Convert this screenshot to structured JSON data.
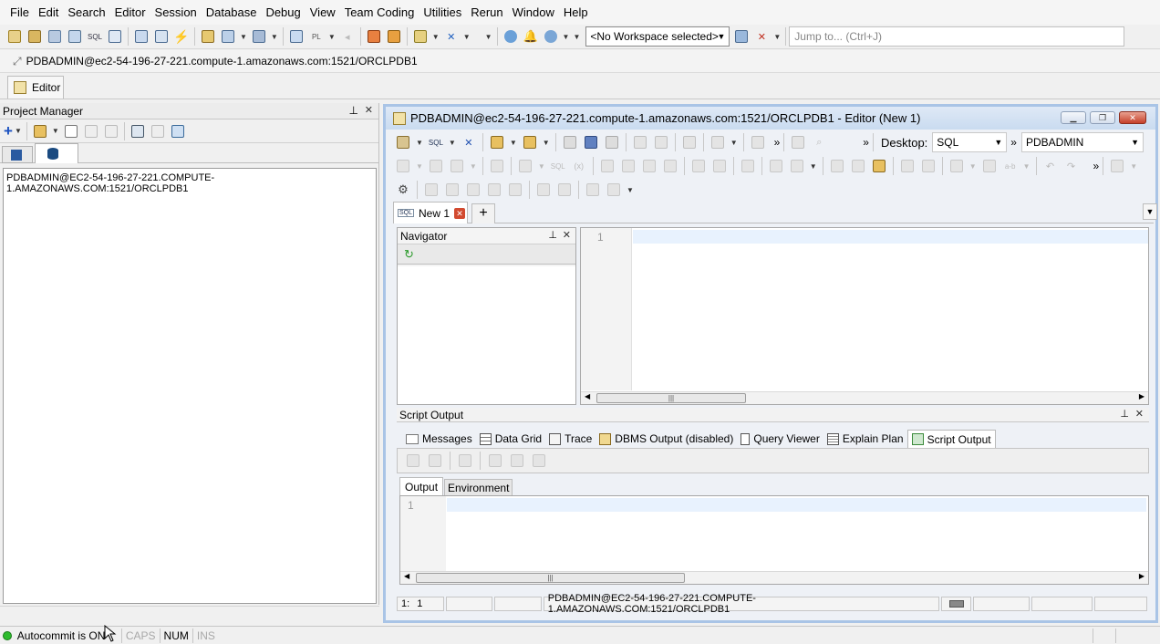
{
  "menu": [
    "File",
    "Edit",
    "Search",
    "Editor",
    "Session",
    "Database",
    "Debug",
    "View",
    "Team Coding",
    "Utilities",
    "Rerun",
    "Window",
    "Help"
  ],
  "toolbar": {
    "workspace": "<No Workspace selected>",
    "jump_placeholder": "Jump to... (Ctrl+J)"
  },
  "connection_bar": "PDBADMIN@ec2-54-196-27-221.compute-1.amazonaws.com:1521/ORCLPDB1",
  "editor_tab": "Editor",
  "project_manager": {
    "title": "Project Manager",
    "connection_item": "PDBADMIN@EC2-54-196-27-221.COMPUTE-1.AMAZONAWS.COM:1521/ORCLPDB1"
  },
  "editor_window": {
    "title": "PDBADMIN@ec2-54-196-27-221.compute-1.amazonaws.com:1521/ORCLPDB1 - Editor (New 1)",
    "desktop_label": "Desktop:",
    "desktop_value": "SQL",
    "schema_value": "PDBADMIN",
    "doc_tab": "New 1",
    "navigator_title": "Navigator",
    "line_number": "1"
  },
  "script_output": {
    "title": "Script Output",
    "tabs": [
      "Messages",
      "Data Grid",
      "Trace",
      "DBMS Output (disabled)",
      "Query Viewer",
      "Explain Plan",
      "Script Output"
    ],
    "subtabs": [
      "Output",
      "Environment"
    ],
    "line_number": "1"
  },
  "editor_status": {
    "row": "1:",
    "col": "1",
    "connection": "PDBADMIN@EC2-54-196-27-221.COMPUTE-1.AMAZONAWS.COM:1521/ORCLPDB1"
  },
  "statusbar": {
    "autocommit": "Autocommit is ON",
    "caps": "CAPS",
    "num": "NUM",
    "ins": "INS"
  },
  "colors": {
    "title_gradient_top": "#dfe9f6",
    "window_border": "#a9c4e6",
    "autocommit_green": "#2dbb2d",
    "close_red": "#c6402a"
  }
}
